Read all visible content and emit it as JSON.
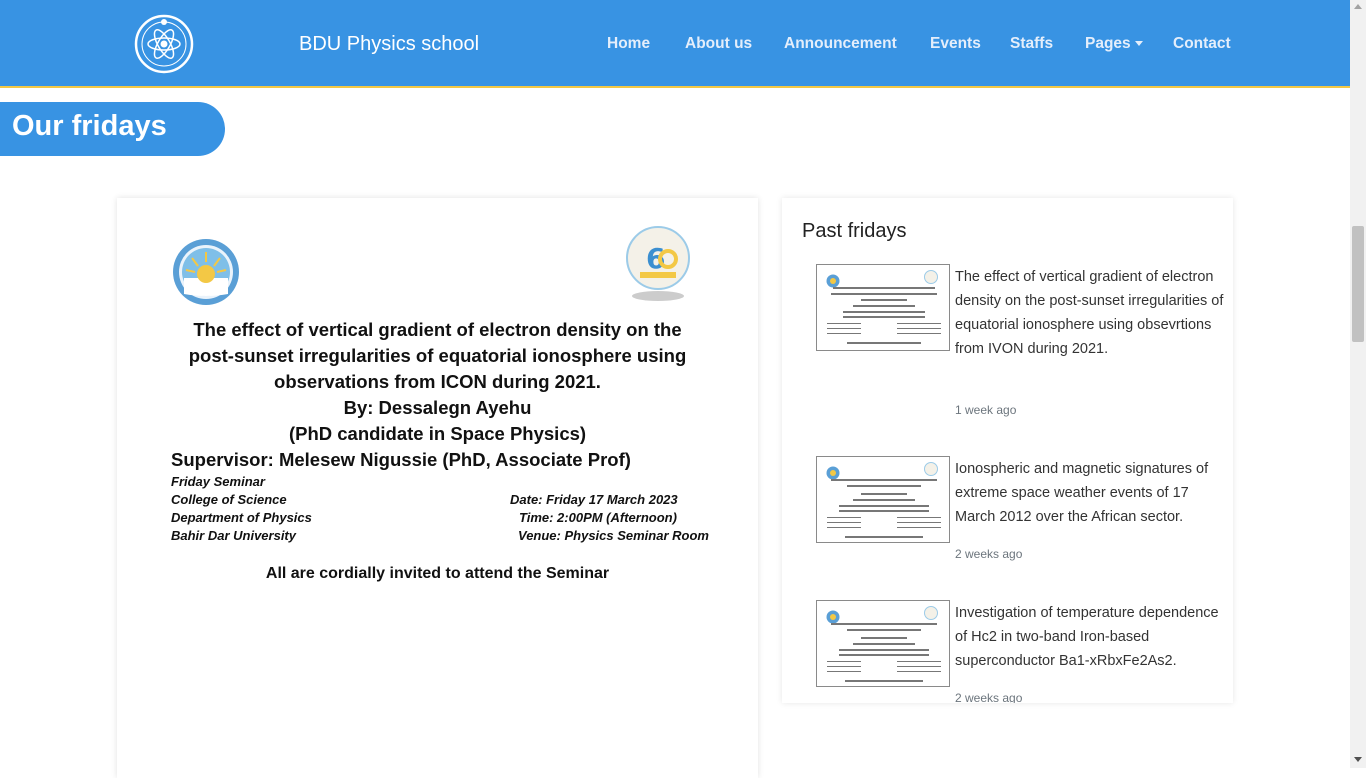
{
  "nav": {
    "brand": "BDU Physics school",
    "items": [
      {
        "label": "Home"
      },
      {
        "label": "About us"
      },
      {
        "label": "Announcement"
      },
      {
        "label": "Events"
      },
      {
        "label": "Staffs"
      },
      {
        "label": "Pages"
      },
      {
        "label": "Contact"
      }
    ]
  },
  "section": {
    "title": "Our fridays"
  },
  "poster": {
    "title_lines": [
      "The effect of vertical gradient of electron density on the",
      "post-sunset irregularities of equatorial ionosphere using",
      "observations from ICON during 2021."
    ],
    "by": "By: Dessalegn Ayehu",
    "candidate": "(PhD candidate in Space Physics)",
    "supervisor": "Supervisor: Melesew Nigussie (PhD, Associate Prof)",
    "left_info": [
      "Friday Seminar",
      "College of Science",
      "Department of Physics",
      "Bahir Dar University"
    ],
    "right_info": [
      "Date: Friday 17 March 2023",
      "Time:  2:00PM (Afternoon)",
      "Venue: Physics Seminar Room"
    ],
    "invite": "All are cordially invited to attend the Seminar"
  },
  "sidebar": {
    "title": "Past fridays",
    "items": [
      {
        "title": "The effect of vertical gradient of electron density on the post-sunset irregularities of equatorial ionosphere using obsevrtions from IVON during 2021.",
        "time": "1 week ago"
      },
      {
        "title": "Ionospheric and magnetic signatures of extreme space weather events of 17 March 2012 over the African sector.",
        "time": "2 weeks ago"
      },
      {
        "title": "Investigation of temperature dependence of Hc2 in two-band Iron-based superconductor Ba1-xRbxFe2As2.",
        "time": "2 weeks ago"
      }
    ]
  },
  "colors": {
    "primary": "#3893e3",
    "accent_border": "#f3c845"
  }
}
